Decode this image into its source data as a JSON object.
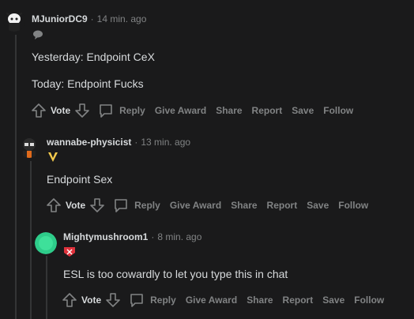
{
  "comments": [
    {
      "author": "MJuniorDC9",
      "time": "14 min. ago",
      "flair_icon": "speech-flair-icon",
      "lines": [
        "Yesterday: Endpoint CeX",
        "Today: Endpoint Fucks"
      ]
    },
    {
      "author": "wannabe-physicist",
      "time": "13 min. ago",
      "flair_icon": "team-vitality-flair-icon",
      "lines": [
        "Endpoint Sex"
      ]
    },
    {
      "author": "Mightymushroom1",
      "time": "8 min. ago",
      "flair_icon": "gambit-flair-icon",
      "lines": [
        "ESL is too cowardly to let you type this in chat"
      ]
    }
  ],
  "actions": {
    "vote": "Vote",
    "reply": "Reply",
    "give_award": "Give Award",
    "share": "Share",
    "report": "Report",
    "save": "Save",
    "follow": "Follow"
  },
  "colors": {
    "background": "#1a1a1b",
    "text": "#d7dadc",
    "muted": "#818384",
    "thread_line": "#343536"
  }
}
